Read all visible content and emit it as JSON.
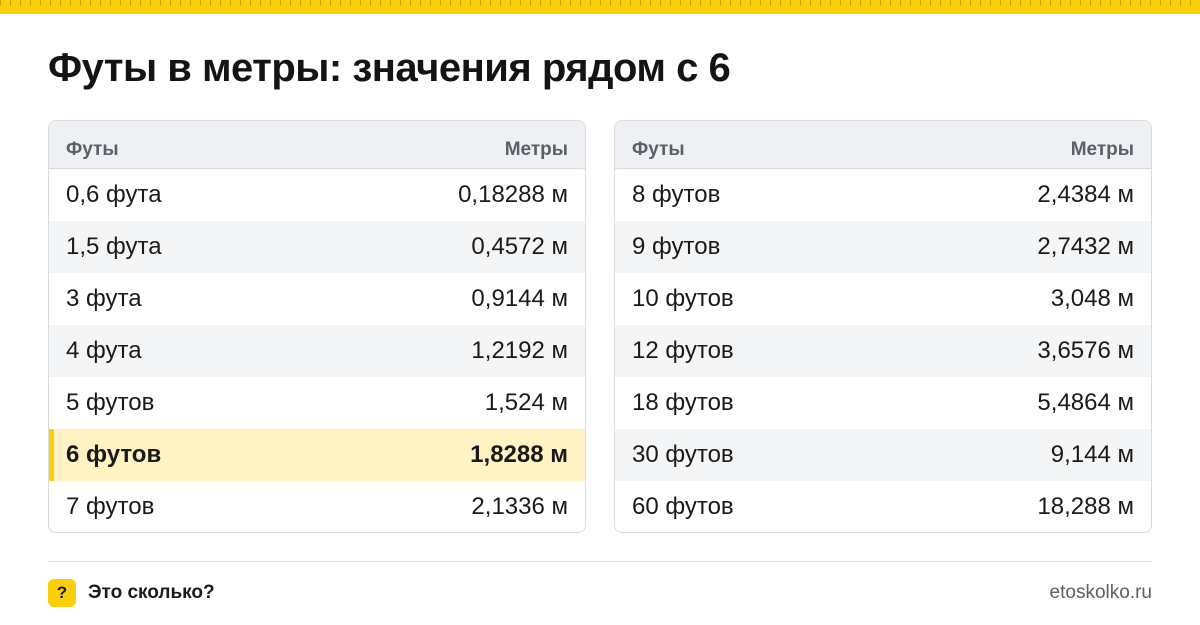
{
  "accent_color": "#f9cf0c",
  "highlight_color": "#fff3c4",
  "title": "Футы в метры: значения рядом с 6",
  "left_table": {
    "header": {
      "col1": "Футы",
      "col2": "Метры"
    },
    "rows": [
      {
        "feet": "0,6 фута",
        "meters": "0,18288 м"
      },
      {
        "feet": "1,5 фута",
        "meters": "0,4572 м"
      },
      {
        "feet": "3 фута",
        "meters": "0,9144 м"
      },
      {
        "feet": "4 фута",
        "meters": "1,2192 м"
      },
      {
        "feet": "5 футов",
        "meters": "1,524 м"
      },
      {
        "feet": "6 футов",
        "meters": "1,8288 м",
        "highlighted": true
      },
      {
        "feet": "7 футов",
        "meters": "2,1336 м"
      }
    ]
  },
  "right_table": {
    "header": {
      "col1": "Футы",
      "col2": "Метры"
    },
    "rows": [
      {
        "feet": "8 футов",
        "meters": "2,4384 м"
      },
      {
        "feet": "9 футов",
        "meters": "2,7432 м"
      },
      {
        "feet": "10 футов",
        "meters": "3,048 м"
      },
      {
        "feet": "12 футов",
        "meters": "3,6576 м"
      },
      {
        "feet": "18 футов",
        "meters": "5,4864 м"
      },
      {
        "feet": "30 футов",
        "meters": "9,144 м"
      },
      {
        "feet": "60 футов",
        "meters": "18,288 м"
      }
    ]
  },
  "footer": {
    "brand_icon_glyph": "?",
    "brand_name": "Это сколько?",
    "site": "etoskolko.ru"
  }
}
